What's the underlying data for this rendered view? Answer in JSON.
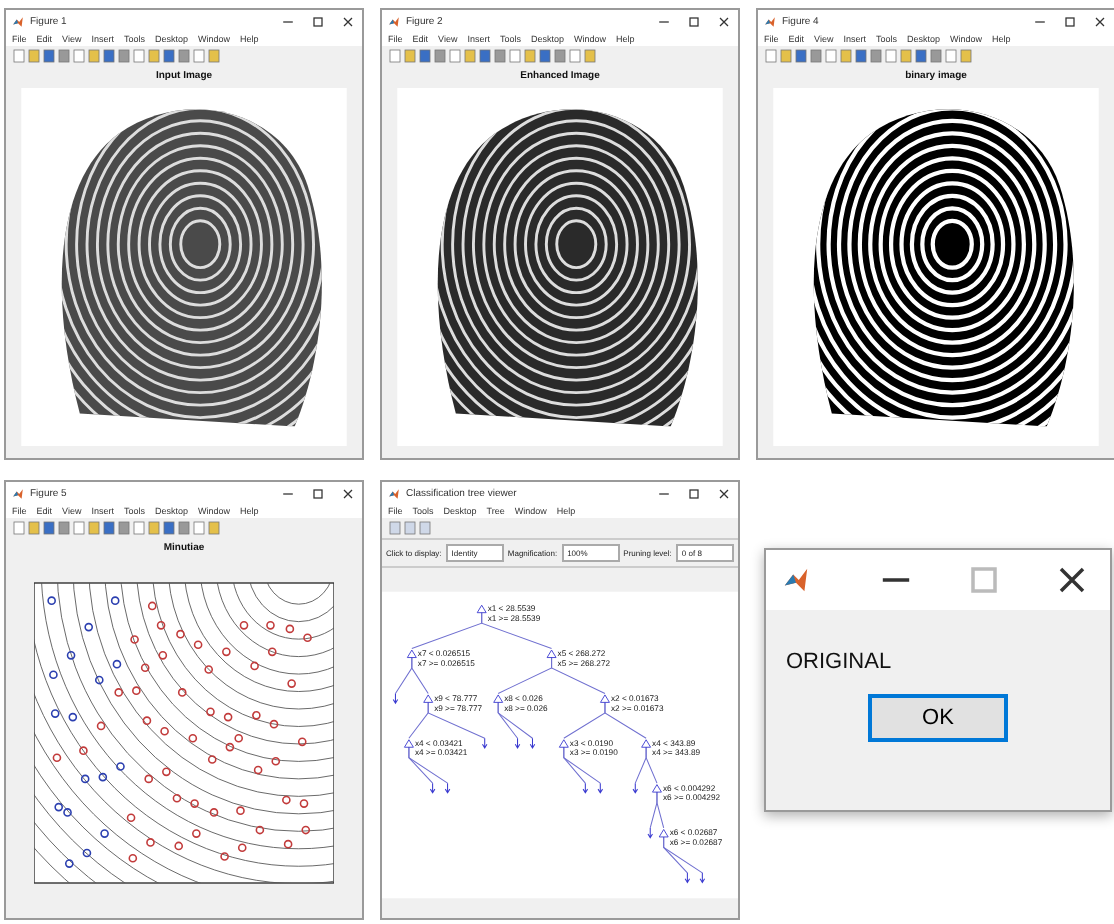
{
  "figures": [
    {
      "title": "Figure 1",
      "menu": [
        "File",
        "Edit",
        "View",
        "Insert",
        "Tools",
        "Desktop",
        "Window",
        "Help"
      ],
      "axes_title": "Input Image",
      "kind": "grayscale"
    },
    {
      "title": "Figure 2",
      "menu": [
        "File",
        "Edit",
        "View",
        "Insert",
        "Tools",
        "Desktop",
        "Window",
        "Help"
      ],
      "axes_title": "Enhanced Image",
      "kind": "enhanced"
    },
    {
      "title": "Figure 4",
      "menu": [
        "File",
        "Edit",
        "View",
        "Insert",
        "Tools",
        "Desktop",
        "Window",
        "Help"
      ],
      "axes_title": "binary image",
      "kind": "binary"
    },
    {
      "title": "Figure 5",
      "menu": [
        "File",
        "Edit",
        "View",
        "Insert",
        "Tools",
        "Desktop",
        "Window",
        "Help"
      ],
      "axes_title": "Minutiae",
      "kind": "minutiae"
    }
  ],
  "tree_viewer": {
    "title": "Classification tree viewer",
    "menu": [
      "File",
      "Tools",
      "Desktop",
      "Tree",
      "Window",
      "Help"
    ],
    "controls": [
      {
        "label": "Click to display:",
        "value": "Identity"
      },
      {
        "label": "Magnification:",
        "value": "100%"
      },
      {
        "label": "Pruning level:",
        "value": "0 of 8"
      }
    ],
    "tree": {
      "kind": "split",
      "left_label": "x1 < 28.5539",
      "right_label": "x1 >= 28.5539",
      "children": [
        {
          "kind": "split",
          "left_label": "x7 < 0.026515",
          "right_label": "x7 >= 0.026515",
          "children": [
            {
              "kind": "leaf"
            },
            {
              "kind": "split",
              "left_label": "x9 < 78.777",
              "right_label": "x9 >= 78.777",
              "children": [
                {
                  "kind": "split",
                  "left_label": "x4 < 0.03421",
                  "right_label": "x4 >= 0.03421",
                  "children": [
                    {
                      "kind": "leaf"
                    },
                    {
                      "kind": "leaf"
                    }
                  ]
                },
                {
                  "kind": "leaf"
                }
              ]
            }
          ]
        },
        {
          "kind": "split",
          "left_label": "x5 < 268.272",
          "right_label": "x5 >= 268.272",
          "children": [
            {
              "kind": "split",
              "left_label": "x8 < 0.026",
              "right_label": "x8 >= 0.026",
              "children": [
                {
                  "kind": "leaf"
                },
                {
                  "kind": "leaf"
                }
              ]
            },
            {
              "kind": "split",
              "left_label": "x2 < 0.01673",
              "right_label": "x2 >= 0.01673",
              "children": [
                {
                  "kind": "split",
                  "left_label": "x3 < 0.0190",
                  "right_label": "x3 >= 0.0190",
                  "children": [
                    {
                      "kind": "leaf"
                    },
                    {
                      "kind": "leaf"
                    }
                  ]
                },
                {
                  "kind": "split",
                  "left_label": "x4 < 343.89",
                  "right_label": "x4 >= 343.89",
                  "children": [
                    {
                      "kind": "leaf"
                    },
                    {
                      "kind": "split",
                      "left_label": "x6 < 0.004292",
                      "right_label": "x6 >= 0.004292",
                      "children": [
                        {
                          "kind": "leaf"
                        },
                        {
                          "kind": "split",
                          "left_label": "x6 < 0.02687",
                          "right_label": "x6 >= 0.02687",
                          "children": [
                            {
                              "kind": "leaf"
                            },
                            {
                              "kind": "leaf"
                            }
                          ]
                        }
                      ]
                    }
                  ]
                }
              ]
            }
          ]
        }
      ]
    }
  },
  "dialog": {
    "message": "ORIGINAL",
    "button": "OK"
  }
}
